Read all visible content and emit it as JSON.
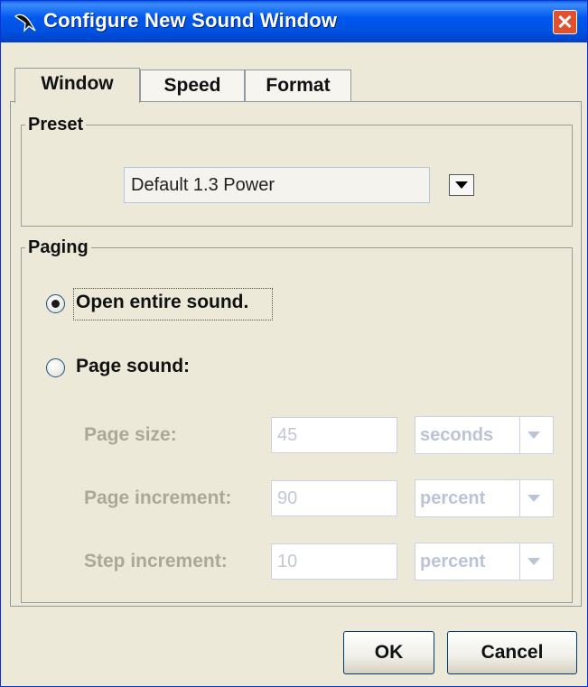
{
  "window": {
    "title": "Configure New Sound Window",
    "close_glyph": "✕",
    "app_icon": "wing-icon"
  },
  "tabs": [
    {
      "label": "Window",
      "active": true
    },
    {
      "label": "Speed",
      "active": false
    },
    {
      "label": "Format",
      "active": false
    }
  ],
  "preset": {
    "legend": "Preset",
    "selected": "Default 1.3 Power"
  },
  "paging": {
    "legend": "Paging",
    "options": [
      {
        "label": "Open entire sound.",
        "checked": true
      },
      {
        "label": "Page sound:",
        "checked": false
      }
    ],
    "fields": [
      {
        "label": "Page size:",
        "value": "45",
        "unit": "seconds"
      },
      {
        "label": "Page increment:",
        "value": "90",
        "unit": "percent"
      },
      {
        "label": "Step increment:",
        "value": "10",
        "unit": "percent"
      }
    ]
  },
  "buttons": {
    "ok": "OK",
    "cancel": "Cancel"
  },
  "colors": {
    "titlebar": "#0058ee",
    "dialog_bg": "#ece9d8",
    "close": "#e2512f",
    "disabled_text": "#aca899"
  }
}
